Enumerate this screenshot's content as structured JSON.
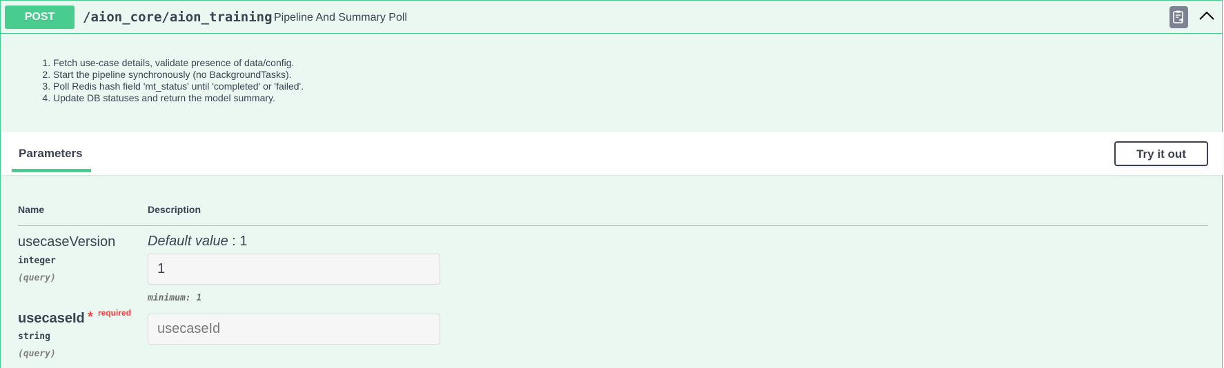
{
  "operation": {
    "method": "POST",
    "path": "/aion_core/aion_training",
    "summary": "Pipeline And Summary Poll",
    "method_color": "#49cc90",
    "background_color": "#ebf7f1"
  },
  "description": {
    "steps": [
      "Fetch use-case details, validate presence of data/config.",
      "Start the pipeline synchronously (no BackgroundTasks).",
      "Poll Redis hash field 'mt_status' until 'completed' or 'failed'.",
      "Update DB statuses and return the model summary."
    ]
  },
  "parameters_section": {
    "tab_label": "Parameters",
    "try_button_label": "Try it out",
    "columns": {
      "name": "Name",
      "description": "Description"
    }
  },
  "parameters": [
    {
      "name": "usecaseVersion",
      "type": "integer",
      "location": "(query)",
      "required": false,
      "default_label": "Default value",
      "default_sep": " : ",
      "default_value": "1",
      "input_value": "1",
      "placeholder": "",
      "constraint": "minimum: 1"
    },
    {
      "name": "usecaseId",
      "type": "string",
      "location": "(query)",
      "required": true,
      "required_mark": "*",
      "required_label": "required",
      "input_value": "",
      "placeholder": "usecaseId"
    }
  ],
  "icons": {
    "copy": "copy-to-clipboard-icon",
    "collapse": "chevron-up-icon"
  }
}
